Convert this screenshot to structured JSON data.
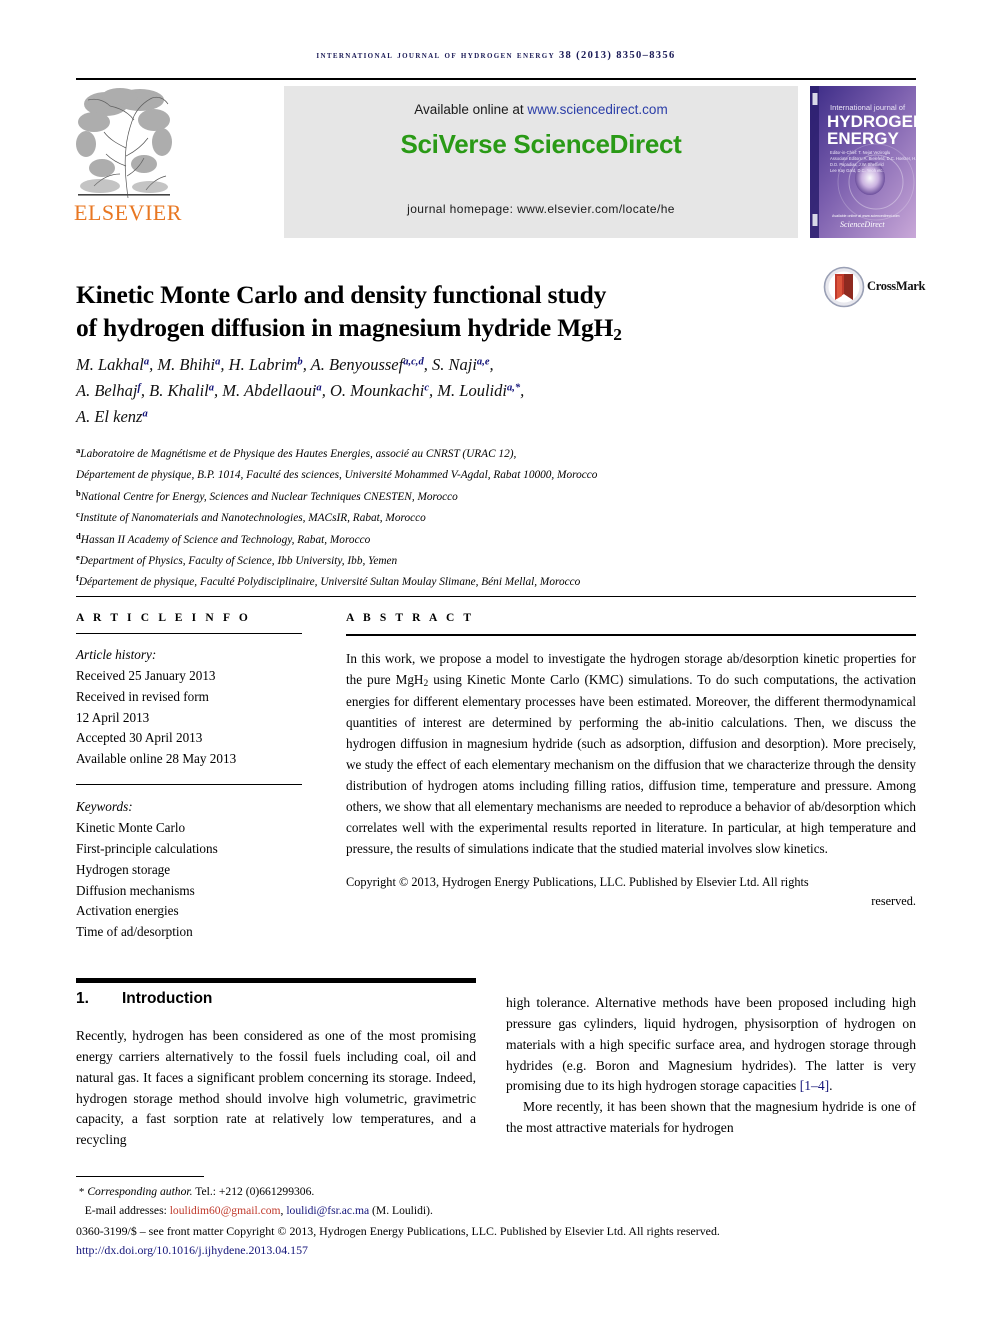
{
  "running_head": "international journal of hydrogen energy 38 (2013) 8350–8356",
  "masthead": {
    "available_prefix": "Available online at ",
    "available_url": "www.sciencedirect.com",
    "brand": "SciVerse ScienceDirect",
    "homepage": "journal homepage: www.elsevier.com/locate/he",
    "publisher_wordmark": "ELSEVIER",
    "cover": {
      "line1": "International journal of",
      "line2": "HYDROGEN",
      "line3": "ENERGY",
      "sciencedirect_label": "ScienceDirect"
    }
  },
  "article": {
    "title_line1": "Kinetic Monte Carlo and density functional study",
    "title_line2_pre": "of hydrogen diffusion in magnesium hydride MgH",
    "title_line2_sub": "2",
    "crossmark_label": "CrossMark"
  },
  "authors": [
    {
      "name": "M. Lakhal",
      "sup": "a",
      "sep": ", "
    },
    {
      "name": "M. Bhihi",
      "sup": "a",
      "sep": ", "
    },
    {
      "name": "H. Labrim",
      "sup": "b",
      "sep": ", "
    },
    {
      "name": "A. Benyoussef",
      "sup": "a,c,d",
      "sep": ", "
    },
    {
      "name": "S. Naji",
      "sup": "a,e",
      "sep": ","
    },
    {
      "name": "A. Belhaj",
      "sup": "f",
      "sep": ", "
    },
    {
      "name": "B. Khalil",
      "sup": "a",
      "sep": ", "
    },
    {
      "name": "M. Abdellaoui",
      "sup": "a",
      "sep": ", "
    },
    {
      "name": "O. Mounkachi",
      "sup": "c",
      "sep": ", "
    },
    {
      "name": "M. Loulidi",
      "sup": "a,*",
      "sep": ","
    },
    {
      "name": "A. El kenz",
      "sup": "a",
      "sep": ""
    }
  ],
  "affiliations": [
    {
      "mark": "a",
      "text": "Laboratoire de Magnétisme et de Physique des Hautes Energies, associé au CNRST (URAC 12),"
    },
    {
      "mark": "",
      "text": "Département de physique, B.P. 1014, Faculté des sciences, Université Mohammed V-Agdal, Rabat 10000, Morocco"
    },
    {
      "mark": "b",
      "text": "National Centre for Energy, Sciences and Nuclear Techniques CNESTEN, Morocco"
    },
    {
      "mark": "c",
      "text": "Institute of Nanomaterials and Nanotechnologies, MACsIR, Rabat, Morocco"
    },
    {
      "mark": "d",
      "text": "Hassan II Academy of Science and Technology, Rabat, Morocco"
    },
    {
      "mark": "e",
      "text": "Department of Physics, Faculty of Science, Ibb University, Ibb, Yemen"
    },
    {
      "mark": "f",
      "text": "Département de physique, Faculté Polydisciplinaire, Université Sultan Moulay Slimane, Béni Mellal, Morocco"
    }
  ],
  "article_info": {
    "heading": "A R T I C L E   I N F O",
    "history_label": "Article history:",
    "history": [
      "Received 25 January 2013",
      "Received in revised form",
      "12 April 2013",
      "Accepted 30 April 2013",
      "Available online 28 May 2013"
    ],
    "keywords_label": "Keywords:",
    "keywords": [
      "Kinetic Monte Carlo",
      "First-principle calculations",
      "Hydrogen storage",
      "Diffusion mechanisms",
      "Activation energies",
      "Time of ad/desorption"
    ]
  },
  "abstract": {
    "heading": "A B S T R A C T",
    "part1": "In this work, we propose a model to investigate the hydrogen storage ab/desorption kinetic properties for the pure MgH",
    "sub": "2",
    "part2": " using Kinetic Monte Carlo (KMC) simulations. To do such computations, the activation energies for different elementary processes have been estimated. Moreover, the different thermodynamical quantities of interest are determined by performing the ab-initio calculations. Then, we discuss the hydrogen diffusion in magnesium hydride (such as adsorption, diffusion and desorption). More precisely, we study the effect of each elementary mechanism on the diffusion that we characterize through the density distribution of hydrogen atoms including filling ratios, diffusion time, temperature and pressure. Among others, we show that all elementary mechanisms are needed to reproduce a behavior of ab/desorption which correlates well with the experimental results reported in literature. In particular, at high temperature and pressure, the results of simulations indicate that the studied material involves slow kinetics.",
    "copyright_main": "Copyright © 2013, Hydrogen Energy Publications, LLC. Published by Elsevier Ltd. All rights",
    "copyright_last": "reserved."
  },
  "section": {
    "number": "1.",
    "title": "Introduction"
  },
  "body": {
    "left_para1": "Recently, hydrogen has been considered as one of the most promising energy carriers alternatively to the fossil fuels including coal, oil and natural gas. It faces a significant problem concerning its storage. Indeed, hydrogen storage method should involve high volumetric, gravimetric capacity, a fast sorption rate at relatively low temperatures, and a recycling",
    "right_para1_pre": "high tolerance. Alternative methods have been proposed including high pressure gas cylinders, liquid hydrogen, physisorption of hydrogen on materials with a high specific surface area, and hydrogen storage through hydrides (e.g. Boron and Magnesium hydrides). The latter is very promising due to its high hydrogen storage capacities ",
    "right_para1_ref": "[1–4]",
    "right_para1_post": ".",
    "right_para2": "More recently, it has been shown that the magnesium hydride is one of the most attractive materials for hydrogen"
  },
  "footnote": {
    "star": "*",
    "corresponding_label": "Corresponding author.",
    "tel": " Tel.: +212 (0)661299306.",
    "email_label": "E-mail addresses: ",
    "email1": "loulidim60@gmail.com",
    "email_sep": ", ",
    "email2": "loulidi@fsr.ac.ma",
    "email_tail": " (M. Loulidi)."
  },
  "frontmatter": {
    "line1": "0360-3199/$ – see front matter Copyright © 2013, Hydrogen Energy Publications, LLC. Published by Elsevier Ltd. All rights reserved.",
    "doi": "http://dx.doi.org/10.1016/j.ijhydene.2013.04.157"
  },
  "colors": {
    "sciencedirect_green": "#2a9a16",
    "link_blue": "#2b3ea8",
    "elsevier_orange": "#e87722",
    "ref_navy": "#14147a",
    "email_red": "#c0392b"
  }
}
